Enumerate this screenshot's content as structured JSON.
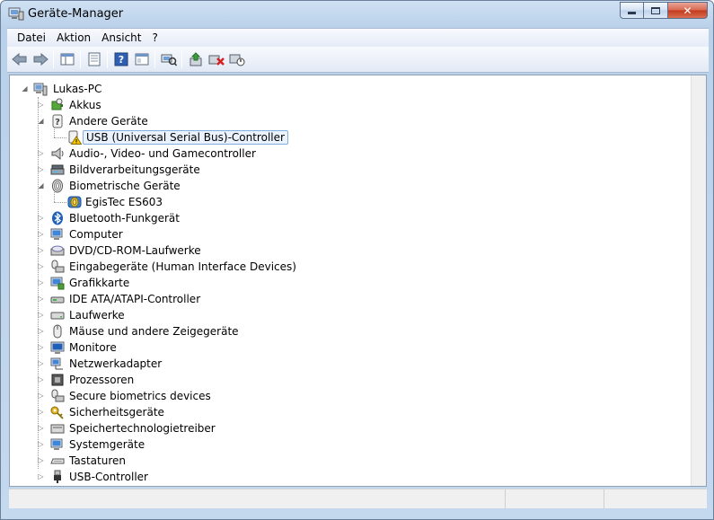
{
  "window": {
    "title": "Geräte-Manager",
    "close_glyph": "✕"
  },
  "menu": [
    "Datei",
    "Aktion",
    "Ansicht",
    "?"
  ],
  "toolbar": {
    "icons": [
      "back-icon",
      "forward-icon",
      "console-tree-icon",
      "properties-icon",
      "help-icon",
      "show-hide-icon",
      "scan-hardware-icon",
      "update-driver-icon",
      "uninstall-icon",
      "disable-icon"
    ]
  },
  "tree": {
    "root": "Lukas-PC",
    "items": [
      {
        "label": "Akkus",
        "icon": "battery-icon",
        "expanded": false
      },
      {
        "label": "Andere Geräte",
        "icon": "unknown-device-icon",
        "expanded": true,
        "children": [
          {
            "label": "USB (Universal Serial Bus)-Controller",
            "icon": "warning-device-icon",
            "selected": true
          }
        ]
      },
      {
        "label": "Audio-, Video- und Gamecontroller",
        "icon": "speaker-icon",
        "expanded": false
      },
      {
        "label": "Bildverarbeitungsgeräte",
        "icon": "scanner-icon",
        "expanded": false
      },
      {
        "label": "Biometrische Geräte",
        "icon": "fingerprint-icon",
        "expanded": true,
        "children": [
          {
            "label": "EgisTec ES603",
            "icon": "fingerprint-reader-icon",
            "selected": false
          }
        ]
      },
      {
        "label": "Bluetooth-Funkgerät",
        "icon": "bluetooth-icon",
        "expanded": false
      },
      {
        "label": "Computer",
        "icon": "computer-icon",
        "expanded": false
      },
      {
        "label": "DVD/CD-ROM-Laufwerke",
        "icon": "dvd-drive-icon",
        "expanded": false
      },
      {
        "label": "Eingabegeräte (Human Interface Devices)",
        "icon": "hid-icon",
        "expanded": false
      },
      {
        "label": "Grafikkarte",
        "icon": "display-adapter-icon",
        "expanded": false
      },
      {
        "label": "IDE ATA/ATAPI-Controller",
        "icon": "ide-controller-icon",
        "expanded": false
      },
      {
        "label": "Laufwerke",
        "icon": "disk-drive-icon",
        "expanded": false
      },
      {
        "label": "Mäuse und andere Zeigegeräte",
        "icon": "mouse-icon",
        "expanded": false
      },
      {
        "label": "Monitore",
        "icon": "monitor-icon",
        "expanded": false
      },
      {
        "label": "Netzwerkadapter",
        "icon": "network-adapter-icon",
        "expanded": false
      },
      {
        "label": "Prozessoren",
        "icon": "processor-icon",
        "expanded": false
      },
      {
        "label": "Secure biometrics devices",
        "icon": "secure-biometrics-icon",
        "expanded": false
      },
      {
        "label": "Sicherheitsgeräte",
        "icon": "security-key-icon",
        "expanded": false
      },
      {
        "label": "Speichertechnologietreiber",
        "icon": "storage-icon",
        "expanded": false
      },
      {
        "label": "Systemgeräte",
        "icon": "system-device-icon",
        "expanded": false
      },
      {
        "label": "Tastaturen",
        "icon": "keyboard-icon",
        "expanded": false
      },
      {
        "label": "USB-Controller",
        "icon": "usb-plug-icon",
        "expanded": false
      }
    ]
  },
  "colors": {
    "selection_bg": "#eaf3fd",
    "selection_border": "#84acdd",
    "warning_yellow": "#f5c400"
  }
}
